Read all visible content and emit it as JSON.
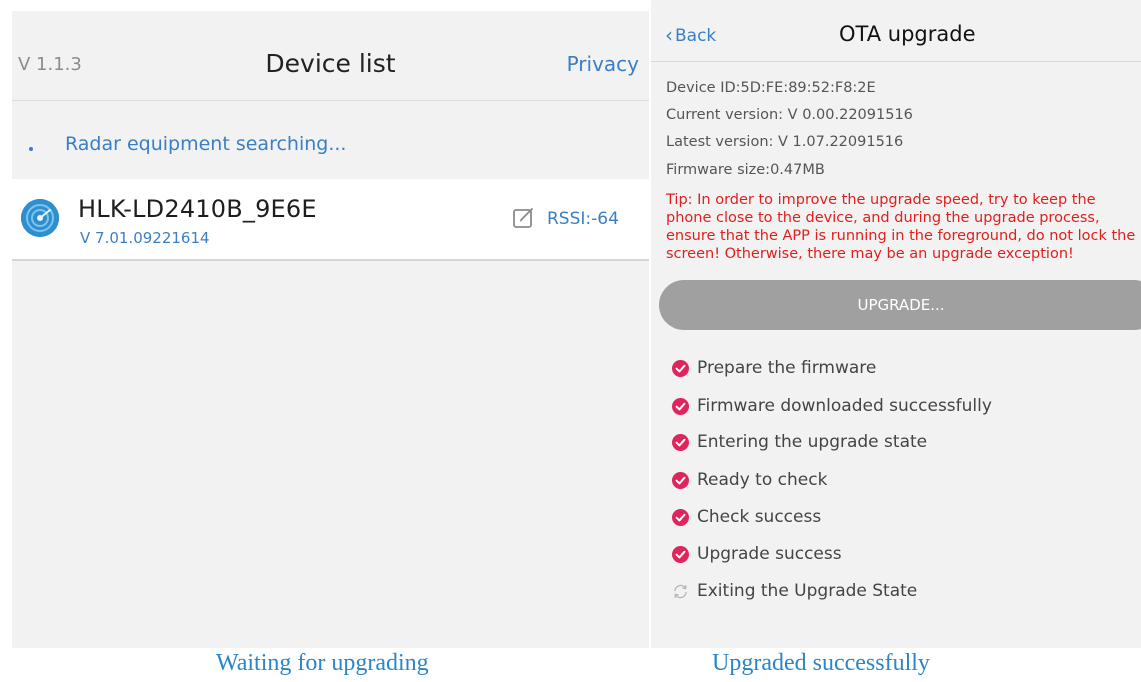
{
  "device_list_screen": {
    "version": "V 1.1.3",
    "title": "Device list",
    "privacy_label": "Privacy",
    "search_status": "Radar equipment searching...",
    "device": {
      "name": "HLK-LD2410B_9E6E",
      "version": "V 7.01.09221614",
      "rssi": "RSSI:-64",
      "icon": "radar-device-icon"
    },
    "caption": "Waiting for upgrading"
  },
  "ota_screen": {
    "back_label": "Back",
    "title": "OTA upgrade",
    "device_id": "Device ID:5D:FE:89:52:F8:2E",
    "current_version": "Current version: V 0.00.22091516",
    "latest_version": "Latest version: V 1.07.22091516",
    "firmware_size": "Firmware size:0.47MB",
    "tip": "Tip: In order to improve the upgrade speed, try to keep the phone close to the device, and during the upgrade process, ensure that the APP is running in the foreground, do not lock the screen! Otherwise, there may be an upgrade exception!",
    "upgrade_button_label": "UPGRADE...",
    "steps": [
      {
        "label": "Prepare the firmware",
        "status": "done"
      },
      {
        "label": "Firmware downloaded successfully",
        "status": "done"
      },
      {
        "label": "Entering the upgrade state",
        "status": "done"
      },
      {
        "label": "Ready to check",
        "status": "done"
      },
      {
        "label": "Check success",
        "status": "done"
      },
      {
        "label": "Upgrade success",
        "status": "done"
      },
      {
        "label": "Exiting the Upgrade State",
        "status": "in-progress"
      }
    ],
    "caption": "Upgraded successfully"
  },
  "colors": {
    "accent_blue": "#3a7fc6",
    "warning_red": "#e0201e",
    "check_magenta": "#e0245e",
    "button_gray": "#a0a0a0",
    "caption_blue": "#2a86c8"
  }
}
